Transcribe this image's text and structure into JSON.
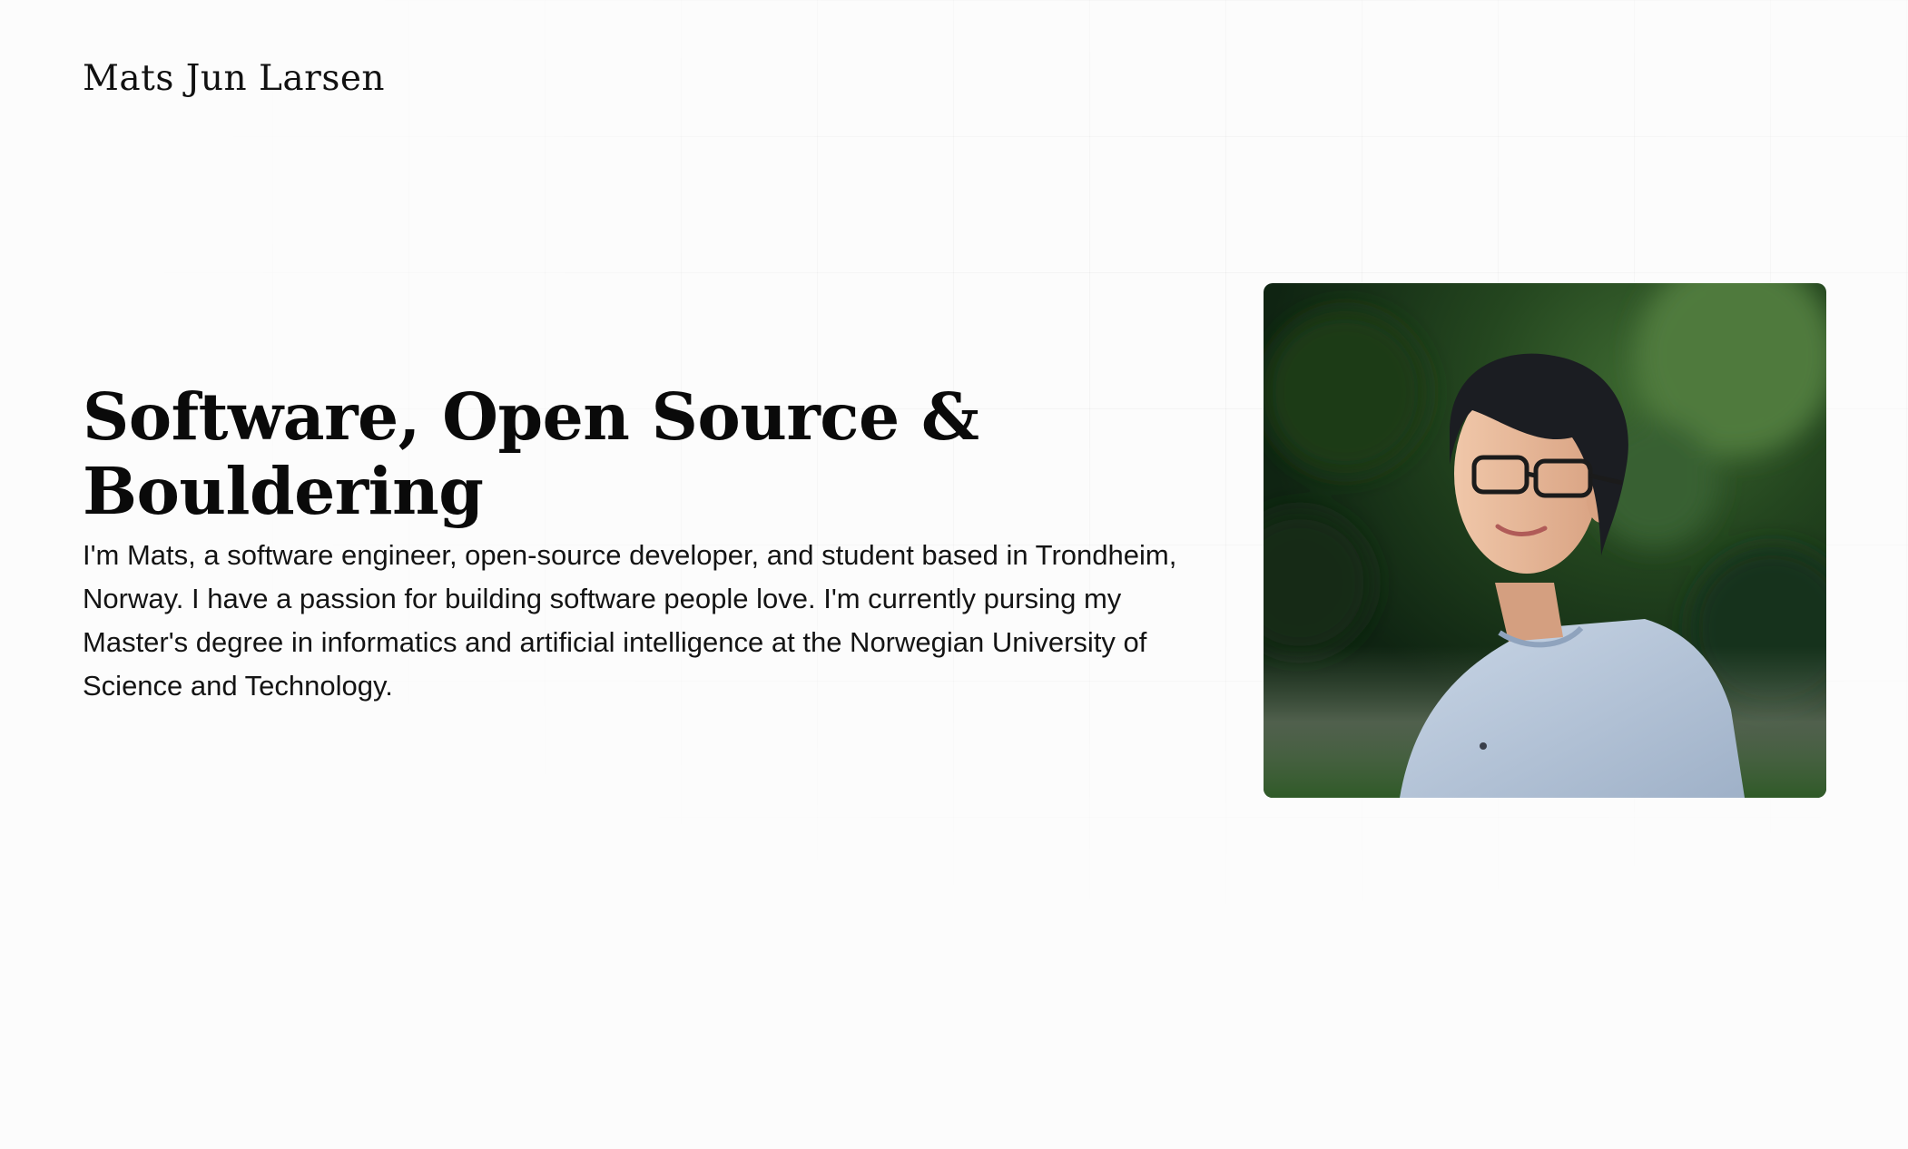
{
  "header": {
    "site_name": "Mats Jun Larsen"
  },
  "hero": {
    "headline": "Software, Open Source & Bouldering",
    "intro": "I'm Mats, a software engineer, open-source developer, and student based in Trondheim, Norway. I have a passion for building software people love. I'm currently pursing my Master's degree in informatics and artificial intelligence at the Norwegian University of Science and Technology."
  },
  "colors": {
    "background": "#fcfcfc",
    "text": "#0b0b0b",
    "photo_foliage": "#24461f",
    "sweater": "#b9c8dc"
  }
}
